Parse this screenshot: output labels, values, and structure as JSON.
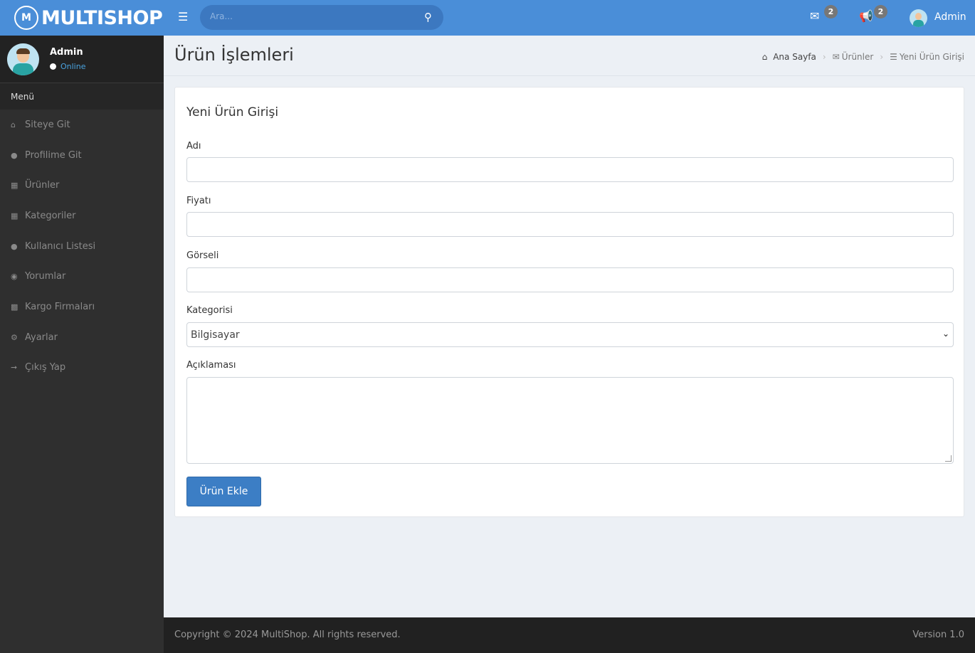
{
  "brand": {
    "logo_letter": "M",
    "name": "MULTISHOP"
  },
  "user": {
    "name": "Admin",
    "status": "Online"
  },
  "sidebar": {
    "header": "Menü",
    "items": [
      {
        "icon": "home-icon",
        "label": "Siteye Git"
      },
      {
        "icon": "user-icon",
        "label": "Profilime Git"
      },
      {
        "icon": "grid-icon",
        "label": "Ürünler"
      },
      {
        "icon": "grid-icon",
        "label": "Kategoriler"
      },
      {
        "icon": "users-icon",
        "label": "Kullanıcı Listesi"
      },
      {
        "icon": "comments-icon",
        "label": "Yorumlar"
      },
      {
        "icon": "truck-icon",
        "label": "Kargo Firmaları"
      },
      {
        "icon": "gear-icon",
        "label": "Ayarlar"
      },
      {
        "icon": "sign-out-icon",
        "label": "Çıkış Yap"
      }
    ]
  },
  "topbar": {
    "search_placeholder": "Ara...",
    "messages_count": "2",
    "notifications_count": "2",
    "user_name": "Admin"
  },
  "page": {
    "title": "Ürün İşlemleri",
    "breadcrumb": [
      "Ana Sayfa",
      "Ürünler",
      "Yeni Ürün Girişi"
    ]
  },
  "form": {
    "title": "Yeni Ürün Girişi",
    "name_label": "Adı",
    "name_value": "",
    "price_label": "Fiyatı",
    "price_value": "",
    "image_label": "Görseli",
    "image_value": "",
    "category_label": "Kategorisi",
    "category_value": "Bilgisayar",
    "description_label": "Açıklaması",
    "description_value": "",
    "submit_label": "Ürün Ekle"
  },
  "footer": {
    "copyright": "Copyright © 2024 MultiShop. All rights reserved.",
    "version": "Version 1.0"
  },
  "colors": {
    "primary": "#4a8ed8",
    "sidebar": "#2f2f2f",
    "button": "#3c7ec5"
  }
}
